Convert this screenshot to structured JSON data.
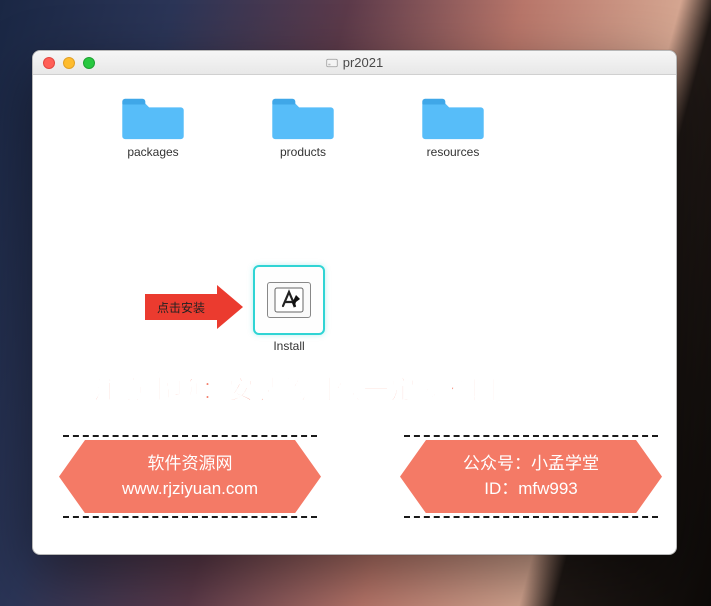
{
  "window": {
    "title": "pr2021"
  },
  "folders": [
    {
      "label": "packages"
    },
    {
      "label": "products"
    },
    {
      "label": "resources"
    }
  ],
  "install": {
    "label": "Install"
  },
  "arrow": {
    "text": "点击安装"
  },
  "notice": "注意事项：安装的时候一定要断网",
  "badges": {
    "left": {
      "line1": "软件资源网",
      "line2": "www.rjziyuan.com"
    },
    "right": {
      "line1": "公众号：小孟学堂",
      "line2": "ID：mfw993"
    }
  }
}
